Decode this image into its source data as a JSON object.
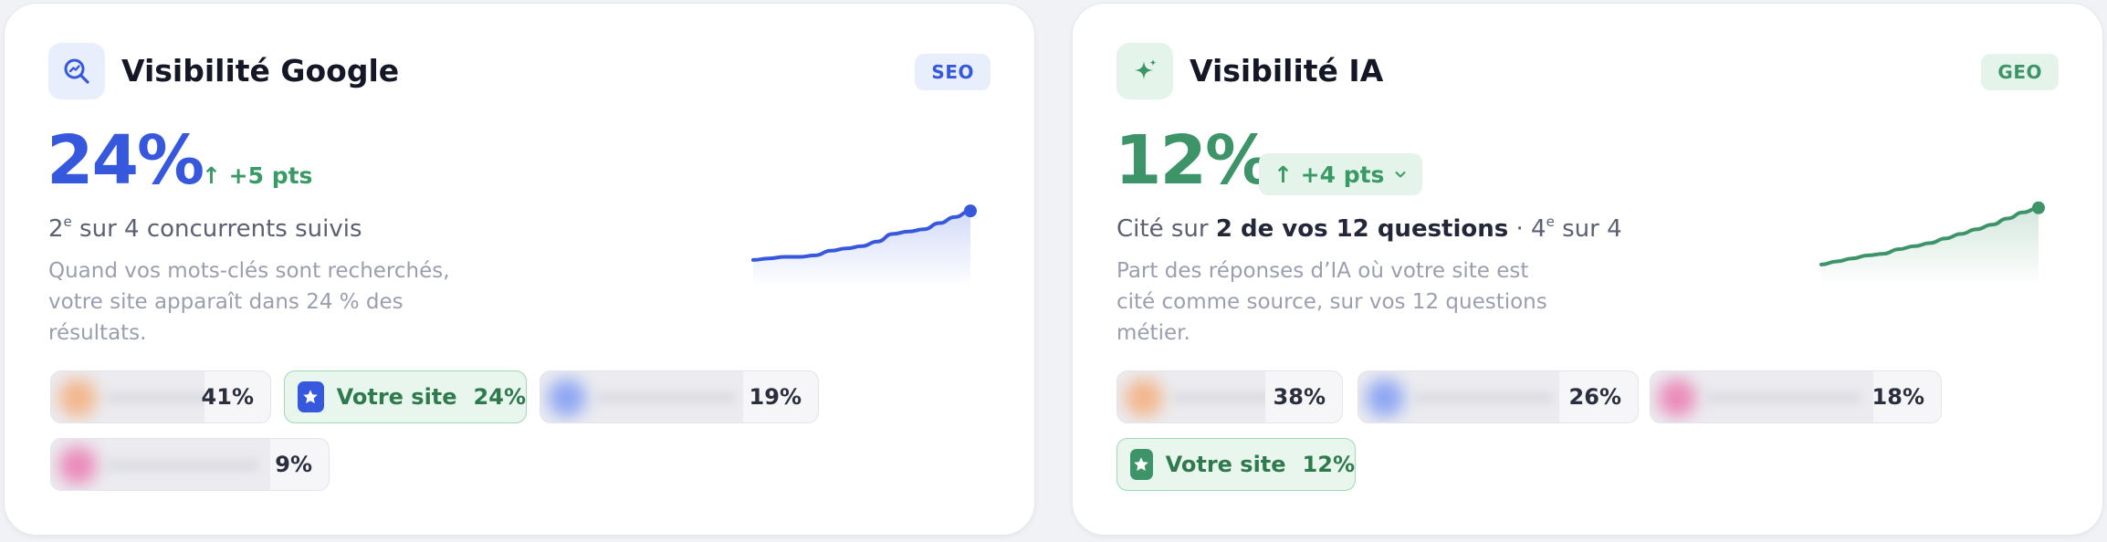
{
  "seo": {
    "title": "Visibilité Google",
    "tag": "SEO",
    "value": "24%",
    "delta": "↑ +5 pts",
    "rank_main": "2",
    "rank_sup": "e",
    "rank_rest": " sur 4 concurrents suivis",
    "description": "Quand vos mots-clés sont recherchés, votre site apparaît dans 24 % des résultats.",
    "sparkline": [
      0.18,
      0.2,
      0.22,
      0.22,
      0.24,
      0.3,
      0.33,
      0.36,
      0.42,
      0.52,
      0.55,
      0.58,
      0.66,
      0.74,
      0.82
    ],
    "competitors": [
      {
        "pct": "41%",
        "blob": "#f4a46b"
      },
      {
        "you": true,
        "label": "Votre site",
        "pct": "24%"
      },
      {
        "pct": "19%",
        "blob": "#6f8ff4"
      },
      {
        "pct": "9%",
        "blob": "#ea6aa8"
      }
    ]
  },
  "geo": {
    "title": "Visibilité IA",
    "tag": "GEO",
    "value": "12%",
    "delta": "↑ +4 pts",
    "cited_prefix": "Cité sur ",
    "cited_bold": "2 de vos 12 questions",
    "cited_suffix": " · 4",
    "cited_sup": "e",
    "cited_end": " sur 4",
    "description": "Part des réponses d’IA où votre site est cité comme source, sur vos 12 questions métier.",
    "sparkline": [
      0.12,
      0.16,
      0.2,
      0.24,
      0.26,
      0.32,
      0.36,
      0.4,
      0.46,
      0.52,
      0.58,
      0.64,
      0.72,
      0.8,
      0.86
    ],
    "competitors": [
      {
        "pct": "38%",
        "blob": "#f4a46b"
      },
      {
        "pct": "26%",
        "blob": "#6f8ff4"
      },
      {
        "pct": "18%",
        "blob": "#ea6aa8"
      },
      {
        "you": true,
        "label": "Votre site",
        "pct": "12%"
      }
    ]
  },
  "colors": {
    "seo_accent": "#3558dd",
    "seo_soft": "#e9eefc",
    "geo_accent": "#3d9468",
    "geo_soft": "#e4f4ea",
    "delta_green": "#3a9a66"
  }
}
